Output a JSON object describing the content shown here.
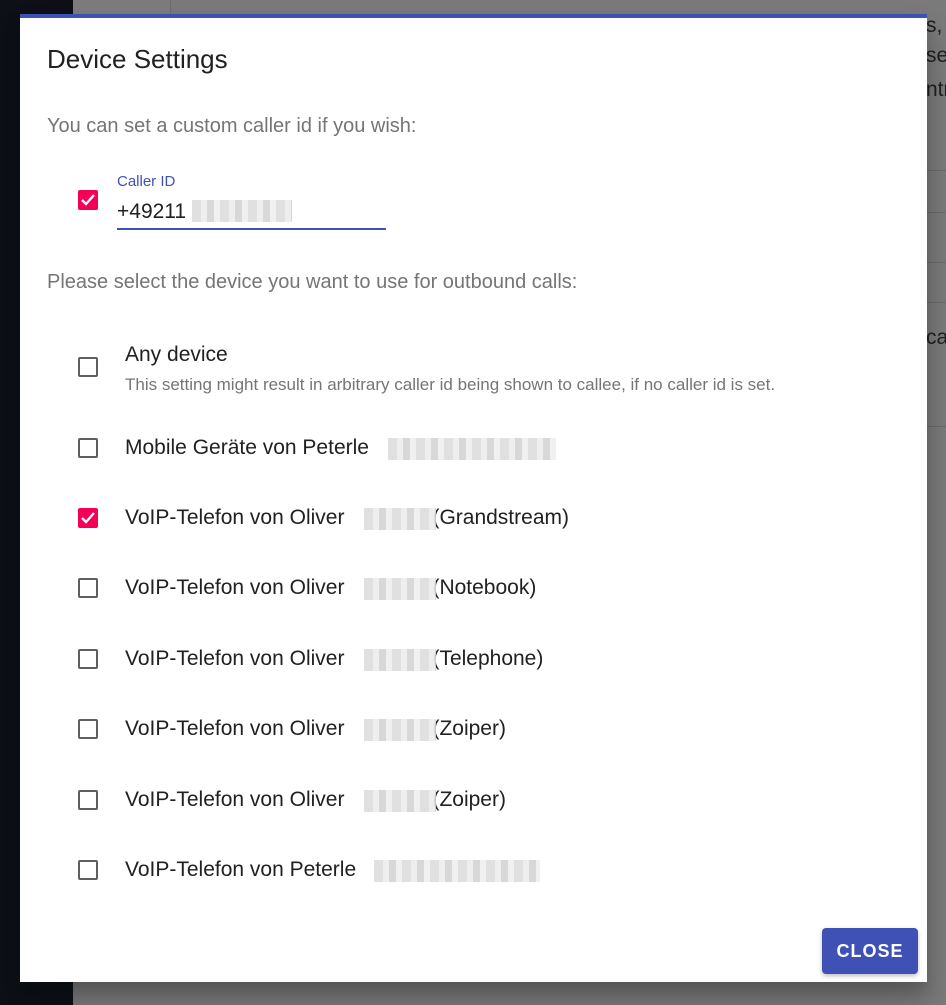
{
  "dialog": {
    "title": "Device Settings",
    "intro": "You can set a custom caller id if you wish:",
    "caller_id": {
      "label": "Caller ID",
      "value": "+49211",
      "checked": true
    },
    "devices_prompt": "Please select the device you want to use for outbound calls:",
    "devices": [
      {
        "label": "Any device",
        "desc": "This setting might result in arbitrary caller id being shown to callee, if no caller id is set.",
        "checked": false
      },
      {
        "label": "Mobile Geräte von Peterle",
        "suffix": "",
        "checked": false
      },
      {
        "label": "VoIP-Telefon von Oliver",
        "suffix": "(Grandstream)",
        "checked": true
      },
      {
        "label": "VoIP-Telefon von Oliver",
        "suffix": "(Notebook)",
        "checked": false
      },
      {
        "label": "VoIP-Telefon von Oliver",
        "suffix": "(Telephone)",
        "checked": false
      },
      {
        "label": "VoIP-Telefon von Oliver",
        "suffix": "(Zoiper)",
        "checked": false
      },
      {
        "label": "VoIP-Telefon von Oliver",
        "suffix": "(Zoiper)",
        "checked": false
      },
      {
        "label": "VoIP-Telefon von Peterle",
        "suffix": "",
        "checked": false
      }
    ],
    "close_label": "CLOSE"
  },
  "colors": {
    "primary": "#3f51b5",
    "accent": "#f50057"
  },
  "background_text": [
    "s,",
    "set",
    "ntr",
    "car"
  ]
}
